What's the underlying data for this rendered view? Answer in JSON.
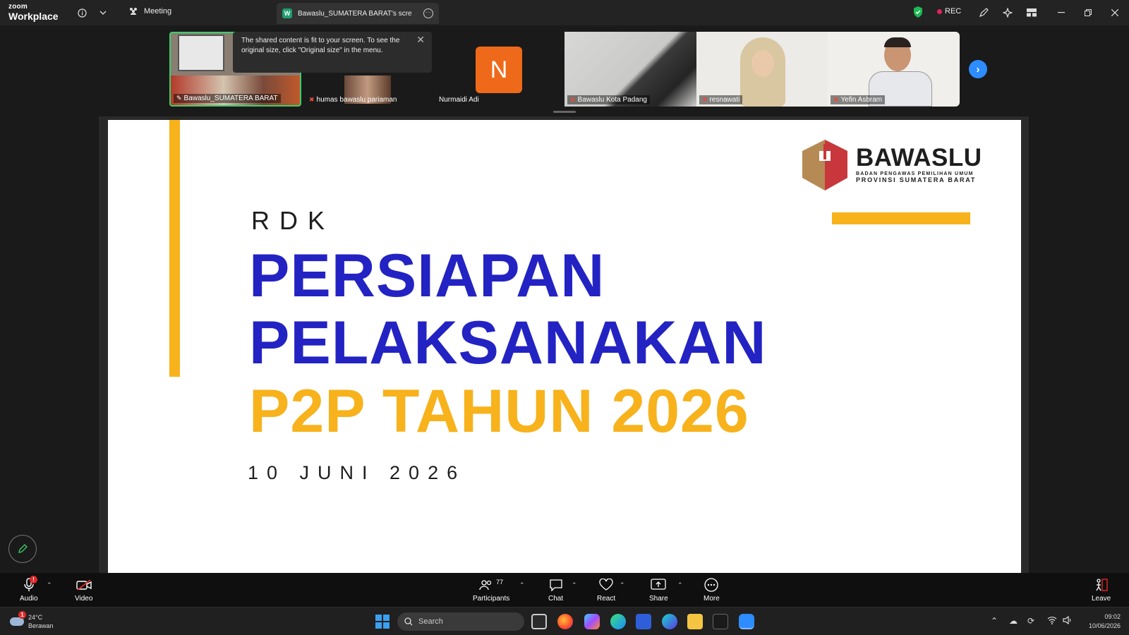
{
  "titlebar": {
    "brand_top": "zoom",
    "brand_bottom": "Workplace",
    "meeting_label": "Meeting",
    "share_tab_label": "Bawaslu_SUMATERA BARAT's scre",
    "share_tab_letter": "W",
    "rec_label": "REC"
  },
  "tooltip": {
    "text": "The shared content is fit to your screen. To see the original size, click \"Original size\" in the menu."
  },
  "participants": [
    {
      "name": "Bawaslu_SUMATERA BARAT"
    },
    {
      "name": "humas bawaslu pariaman"
    },
    {
      "name": "Nurmaidi Adi",
      "initial": "N"
    },
    {
      "name": "Bawaslu Kota Padang"
    },
    {
      "name": "resnawati"
    },
    {
      "name": "Yefin Asbram"
    }
  ],
  "slide": {
    "kicker": "RDK",
    "title_line1": "PERSIAPAN",
    "title_line2": "PELAKSANAKAN",
    "title_line3": "P2P TAHUN 2026",
    "date": "10 JUNI 2026",
    "org_name": "BAWASLU",
    "org_sub1": "BADAN PENGAWAS PEMILIHAN UMUM",
    "org_sub2": "PROVINSI SUMATERA BARAT",
    "colors": {
      "title": "#2323c3",
      "accent": "#f7b21c"
    }
  },
  "toolbar": {
    "audio": "Audio",
    "audio_badge": "!",
    "video": "Video",
    "participants": "Participants",
    "participants_count": "77",
    "chat": "Chat",
    "react": "React",
    "share": "Share",
    "more": "More",
    "leave": "Leave"
  },
  "taskbar": {
    "temperature": "24°C",
    "weather": "Berawan",
    "weather_badge": "1",
    "search_placeholder": "Search",
    "time": "09:02",
    "date": "10/06/2026"
  }
}
